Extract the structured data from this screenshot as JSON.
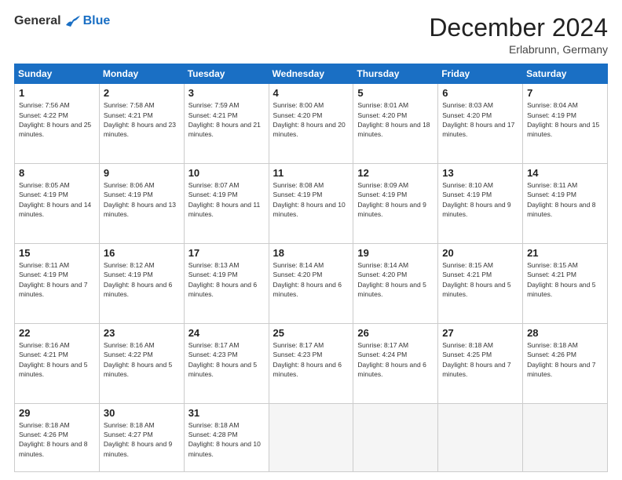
{
  "header": {
    "logo_general": "General",
    "logo_blue": "Blue",
    "month_title": "December 2024",
    "location": "Erlabrunn, Germany"
  },
  "days_of_week": [
    "Sunday",
    "Monday",
    "Tuesday",
    "Wednesday",
    "Thursday",
    "Friday",
    "Saturday"
  ],
  "weeks": [
    [
      {
        "day": "1",
        "sunrise": "7:56 AM",
        "sunset": "4:22 PM",
        "daylight": "8 hours and 25 minutes."
      },
      {
        "day": "2",
        "sunrise": "7:58 AM",
        "sunset": "4:21 PM",
        "daylight": "8 hours and 23 minutes."
      },
      {
        "day": "3",
        "sunrise": "7:59 AM",
        "sunset": "4:21 PM",
        "daylight": "8 hours and 21 minutes."
      },
      {
        "day": "4",
        "sunrise": "8:00 AM",
        "sunset": "4:20 PM",
        "daylight": "8 hours and 20 minutes."
      },
      {
        "day": "5",
        "sunrise": "8:01 AM",
        "sunset": "4:20 PM",
        "daylight": "8 hours and 18 minutes."
      },
      {
        "day": "6",
        "sunrise": "8:03 AM",
        "sunset": "4:20 PM",
        "daylight": "8 hours and 17 minutes."
      },
      {
        "day": "7",
        "sunrise": "8:04 AM",
        "sunset": "4:19 PM",
        "daylight": "8 hours and 15 minutes."
      }
    ],
    [
      {
        "day": "8",
        "sunrise": "8:05 AM",
        "sunset": "4:19 PM",
        "daylight": "8 hours and 14 minutes."
      },
      {
        "day": "9",
        "sunrise": "8:06 AM",
        "sunset": "4:19 PM",
        "daylight": "8 hours and 13 minutes."
      },
      {
        "day": "10",
        "sunrise": "8:07 AM",
        "sunset": "4:19 PM",
        "daylight": "8 hours and 11 minutes."
      },
      {
        "day": "11",
        "sunrise": "8:08 AM",
        "sunset": "4:19 PM",
        "daylight": "8 hours and 10 minutes."
      },
      {
        "day": "12",
        "sunrise": "8:09 AM",
        "sunset": "4:19 PM",
        "daylight": "8 hours and 9 minutes."
      },
      {
        "day": "13",
        "sunrise": "8:10 AM",
        "sunset": "4:19 PM",
        "daylight": "8 hours and 9 minutes."
      },
      {
        "day": "14",
        "sunrise": "8:11 AM",
        "sunset": "4:19 PM",
        "daylight": "8 hours and 8 minutes."
      }
    ],
    [
      {
        "day": "15",
        "sunrise": "8:11 AM",
        "sunset": "4:19 PM",
        "daylight": "8 hours and 7 minutes."
      },
      {
        "day": "16",
        "sunrise": "8:12 AM",
        "sunset": "4:19 PM",
        "daylight": "8 hours and 6 minutes."
      },
      {
        "day": "17",
        "sunrise": "8:13 AM",
        "sunset": "4:19 PM",
        "daylight": "8 hours and 6 minutes."
      },
      {
        "day": "18",
        "sunrise": "8:14 AM",
        "sunset": "4:20 PM",
        "daylight": "8 hours and 6 minutes."
      },
      {
        "day": "19",
        "sunrise": "8:14 AM",
        "sunset": "4:20 PM",
        "daylight": "8 hours and 5 minutes."
      },
      {
        "day": "20",
        "sunrise": "8:15 AM",
        "sunset": "4:21 PM",
        "daylight": "8 hours and 5 minutes."
      },
      {
        "day": "21",
        "sunrise": "8:15 AM",
        "sunset": "4:21 PM",
        "daylight": "8 hours and 5 minutes."
      }
    ],
    [
      {
        "day": "22",
        "sunrise": "8:16 AM",
        "sunset": "4:21 PM",
        "daylight": "8 hours and 5 minutes."
      },
      {
        "day": "23",
        "sunrise": "8:16 AM",
        "sunset": "4:22 PM",
        "daylight": "8 hours and 5 minutes."
      },
      {
        "day": "24",
        "sunrise": "8:17 AM",
        "sunset": "4:23 PM",
        "daylight": "8 hours and 5 minutes."
      },
      {
        "day": "25",
        "sunrise": "8:17 AM",
        "sunset": "4:23 PM",
        "daylight": "8 hours and 6 minutes."
      },
      {
        "day": "26",
        "sunrise": "8:17 AM",
        "sunset": "4:24 PM",
        "daylight": "8 hours and 6 minutes."
      },
      {
        "day": "27",
        "sunrise": "8:18 AM",
        "sunset": "4:25 PM",
        "daylight": "8 hours and 7 minutes."
      },
      {
        "day": "28",
        "sunrise": "8:18 AM",
        "sunset": "4:26 PM",
        "daylight": "8 hours and 7 minutes."
      }
    ],
    [
      {
        "day": "29",
        "sunrise": "8:18 AM",
        "sunset": "4:26 PM",
        "daylight": "8 hours and 8 minutes."
      },
      {
        "day": "30",
        "sunrise": "8:18 AM",
        "sunset": "4:27 PM",
        "daylight": "8 hours and 9 minutes."
      },
      {
        "day": "31",
        "sunrise": "8:18 AM",
        "sunset": "4:28 PM",
        "daylight": "8 hours and 10 minutes."
      },
      null,
      null,
      null,
      null
    ]
  ]
}
